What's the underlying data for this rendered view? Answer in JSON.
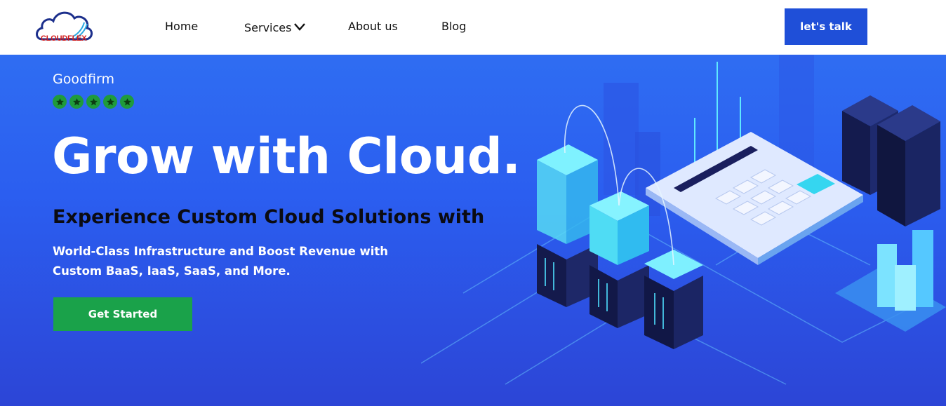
{
  "brand": {
    "logo_text": "CLOUDFLEX",
    "colors": {
      "primary": "#1f4fd8",
      "cta_green": "#1aa24a",
      "logo_red": "#d11b1b"
    }
  },
  "nav": {
    "items": [
      {
        "label": "Home"
      },
      {
        "label": "Services"
      },
      {
        "label": "About us"
      },
      {
        "label": "Blog"
      }
    ],
    "cta_label": "let's talk"
  },
  "hero": {
    "rating_source": "Goodfirm",
    "rating_stars": 5,
    "title": "Grow with Cloud.",
    "subtitle": "Experience Custom Cloud Solutions with",
    "description_line1": "World-Class Infrastructure and Boost Revenue with",
    "description_line2": "Custom BaaS, IaaS, SaaS, and More.",
    "cta_label": "Get Started"
  }
}
